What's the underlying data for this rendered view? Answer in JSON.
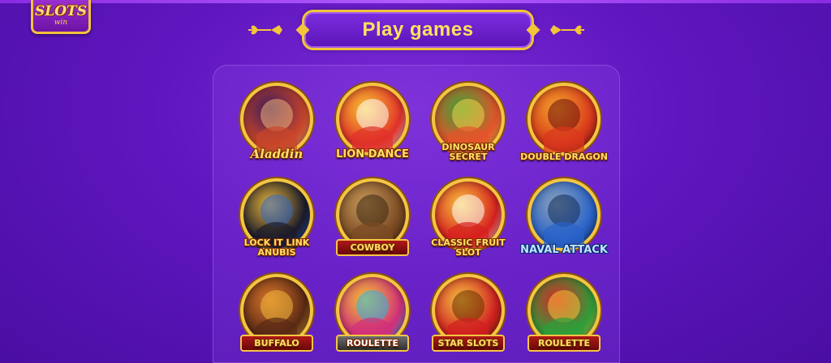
{
  "brand": {
    "logo_main": "SLOTS",
    "logo_sub": "win"
  },
  "header": {
    "title": "Play games"
  },
  "games": [
    {
      "id": "aladdin",
      "label": "Aladdin",
      "style": "italic",
      "colors": [
        "#c9462a",
        "#3b1a5a",
        "#f0b27a"
      ]
    },
    {
      "id": "lion-dance",
      "label": "LION DANCE",
      "style": "plain",
      "colors": [
        "#e1302a",
        "#f7c72f",
        "#ffffff"
      ]
    },
    {
      "id": "dinosaur-secret",
      "label": "DINOSAUR SECRET",
      "style": "two",
      "colors": [
        "#e5542b",
        "#3aa336",
        "#f7d14a"
      ]
    },
    {
      "id": "double-dragon",
      "label": "DOUBLE DRAGON",
      "style": "two",
      "colors": [
        "#d8381c",
        "#f3a629",
        "#6b0d0d"
      ]
    },
    {
      "id": "lock-it-link-anubis",
      "label": "LOCK IT LINK ANUBIS",
      "style": "two",
      "colors": [
        "#1b1b2a",
        "#e5b23a",
        "#3167c9"
      ]
    },
    {
      "id": "cowboy",
      "label": "COWBOY",
      "style": "boxed",
      "colors": [
        "#7a4a23",
        "#c79b5b",
        "#3a2712"
      ]
    },
    {
      "id": "classic-fruit-slot",
      "label": "CLASSIC FRUIT SLOT",
      "style": "two",
      "colors": [
        "#d62020",
        "#f6c53c",
        "#ffffff"
      ]
    },
    {
      "id": "naval-attack",
      "label": "NAVAL ATTACK",
      "style": "blue",
      "colors": [
        "#2a63c9",
        "#8fa4b8",
        "#0f2a5a"
      ]
    },
    {
      "id": "buffalo",
      "label": "BUFFALO",
      "style": "boxed",
      "colors": [
        "#5a2a14",
        "#d9752b",
        "#f1b93a"
      ]
    },
    {
      "id": "3-lucky-roulette",
      "label": "ROULETTE",
      "style": "boxed-gray",
      "colors": [
        "#d12f7a",
        "#f2c531",
        "#2bb3e8"
      ]
    },
    {
      "id": "star-slots",
      "label": "STAR SLOTS",
      "style": "boxed",
      "colors": [
        "#d02020",
        "#f4c542",
        "#6a2f00"
      ]
    },
    {
      "id": "roulette",
      "label": "ROULETTE",
      "style": "boxed",
      "colors": [
        "#2e9e3a",
        "#d92626",
        "#f7c33a"
      ]
    }
  ],
  "colors": {
    "accent": "#f3c53a",
    "background": "#5f16bf",
    "title_text": "#ffe25c"
  }
}
